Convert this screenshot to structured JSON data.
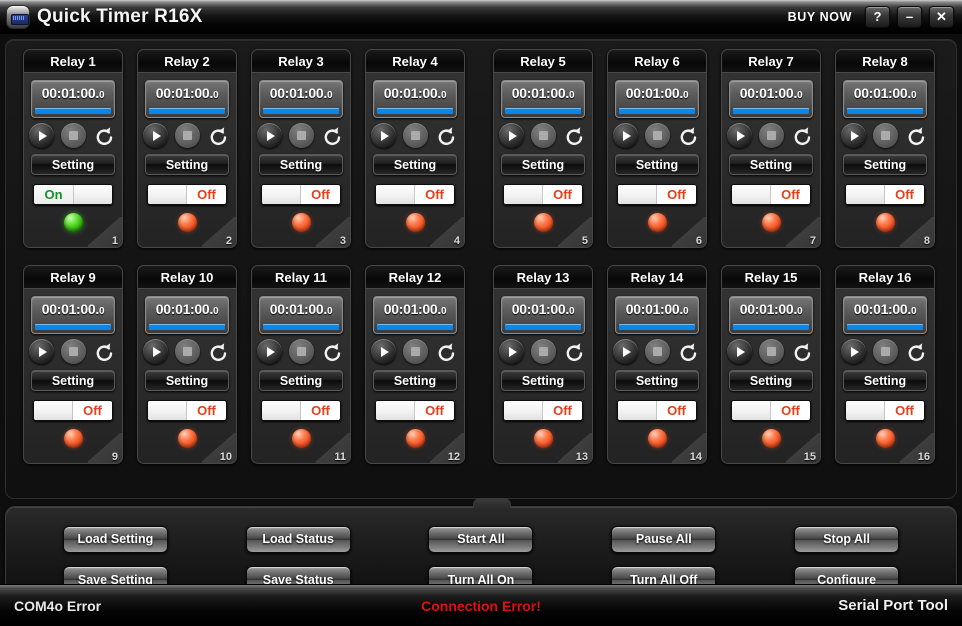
{
  "window": {
    "title": "Quick Timer R16X",
    "app_icon": "timer-app-icon",
    "buy_now": "BUY NOW",
    "help_label": "?",
    "minimize_label": "–",
    "close_label": "✕"
  },
  "relays": [
    {
      "title": "Relay 1",
      "timer": "00:01:00.",
      "fraction": "0",
      "setting": "Setting",
      "toggle_state": "on",
      "toggle_label": "On",
      "led": "green",
      "number": "1"
    },
    {
      "title": "Relay 2",
      "timer": "00:01:00.",
      "fraction": "0",
      "setting": "Setting",
      "toggle_state": "off",
      "toggle_label": "Off",
      "led": "red",
      "number": "2"
    },
    {
      "title": "Relay 3",
      "timer": "00:01:00.",
      "fraction": "0",
      "setting": "Setting",
      "toggle_state": "off",
      "toggle_label": "Off",
      "led": "red",
      "number": "3"
    },
    {
      "title": "Relay 4",
      "timer": "00:01:00.",
      "fraction": "0",
      "setting": "Setting",
      "toggle_state": "off",
      "toggle_label": "Off",
      "led": "red",
      "number": "4"
    },
    {
      "title": "Relay 5",
      "timer": "00:01:00.",
      "fraction": "0",
      "setting": "Setting",
      "toggle_state": "off",
      "toggle_label": "Off",
      "led": "red",
      "number": "5"
    },
    {
      "title": "Relay 6",
      "timer": "00:01:00.",
      "fraction": "0",
      "setting": "Setting",
      "toggle_state": "off",
      "toggle_label": "Off",
      "led": "red",
      "number": "6"
    },
    {
      "title": "Relay 7",
      "timer": "00:01:00.",
      "fraction": "0",
      "setting": "Setting",
      "toggle_state": "off",
      "toggle_label": "Off",
      "led": "red",
      "number": "7"
    },
    {
      "title": "Relay 8",
      "timer": "00:01:00.",
      "fraction": "0",
      "setting": "Setting",
      "toggle_state": "off",
      "toggle_label": "Off",
      "led": "red",
      "number": "8"
    },
    {
      "title": "Relay 9",
      "timer": "00:01:00.",
      "fraction": "0",
      "setting": "Setting",
      "toggle_state": "off",
      "toggle_label": "Off",
      "led": "red",
      "number": "9"
    },
    {
      "title": "Relay 10",
      "timer": "00:01:00.",
      "fraction": "0",
      "setting": "Setting",
      "toggle_state": "off",
      "toggle_label": "Off",
      "led": "red",
      "number": "10"
    },
    {
      "title": "Relay 11",
      "timer": "00:01:00.",
      "fraction": "0",
      "setting": "Setting",
      "toggle_state": "off",
      "toggle_label": "Off",
      "led": "red",
      "number": "11"
    },
    {
      "title": "Relay 12",
      "timer": "00:01:00.",
      "fraction": "0",
      "setting": "Setting",
      "toggle_state": "off",
      "toggle_label": "Off",
      "led": "red",
      "number": "12"
    },
    {
      "title": "Relay 13",
      "timer": "00:01:00.",
      "fraction": "0",
      "setting": "Setting",
      "toggle_state": "off",
      "toggle_label": "Off",
      "led": "red",
      "number": "13"
    },
    {
      "title": "Relay 14",
      "timer": "00:01:00.",
      "fraction": "0",
      "setting": "Setting",
      "toggle_state": "off",
      "toggle_label": "Off",
      "led": "red",
      "number": "14"
    },
    {
      "title": "Relay 15",
      "timer": "00:01:00.",
      "fraction": "0",
      "setting": "Setting",
      "toggle_state": "off",
      "toggle_label": "Off",
      "led": "red",
      "number": "15"
    },
    {
      "title": "Relay 16",
      "timer": "00:01:00.",
      "fraction": "0",
      "setting": "Setting",
      "toggle_state": "off",
      "toggle_label": "Off",
      "led": "red",
      "number": "16"
    }
  ],
  "transport_icons": {
    "play": "play-icon",
    "pause": "pause-stop-icon",
    "reset": "reset-loop-icon"
  },
  "buttons": [
    {
      "label": "Load Setting",
      "name": "load-setting-button"
    },
    {
      "label": "Load Status",
      "name": "load-status-button"
    },
    {
      "label": "Start All",
      "name": "start-all-button"
    },
    {
      "label": "Pause All",
      "name": "pause-all-button"
    },
    {
      "label": "Stop All",
      "name": "stop-all-button"
    },
    {
      "label": "Save Setting",
      "name": "save-setting-button"
    },
    {
      "label": "Save Status",
      "name": "save-status-button"
    },
    {
      "label": "Turn All On",
      "name": "turn-all-on-button"
    },
    {
      "label": "Turn All Off",
      "name": "turn-all-off-button"
    },
    {
      "label": "Configure",
      "name": "configure-button"
    }
  ],
  "statusbar": {
    "left": "COM4o Error",
    "center": "Connection Error!",
    "right": "Serial Port Tool"
  },
  "colors": {
    "timer_bar": "#0b86e8",
    "on_text": "#119427",
    "off_text": "#e2401a",
    "error_text": "#e01010",
    "led_green": "#4ec41f",
    "led_red": "#ef5a23"
  }
}
